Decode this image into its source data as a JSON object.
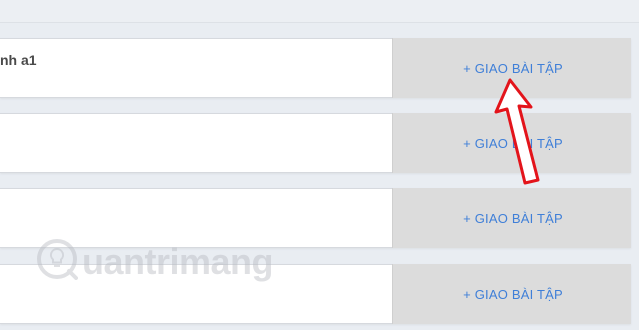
{
  "rows": [
    {
      "title": "nh a1",
      "assign_label": "+ GIAO BÀI TẬP"
    },
    {
      "title": "",
      "assign_label": "+ GIAO BÀI TẬP"
    },
    {
      "title": "",
      "assign_label": "+ GIAO BÀI TẬP"
    },
    {
      "title": "",
      "assign_label": "+ GIAO BÀI TẬP"
    }
  ],
  "watermark": {
    "text": "uantrimang",
    "icon": "lightbulb-icon"
  },
  "annotation": {
    "icon": "red-arrow-icon",
    "color": "#e3141b"
  }
}
